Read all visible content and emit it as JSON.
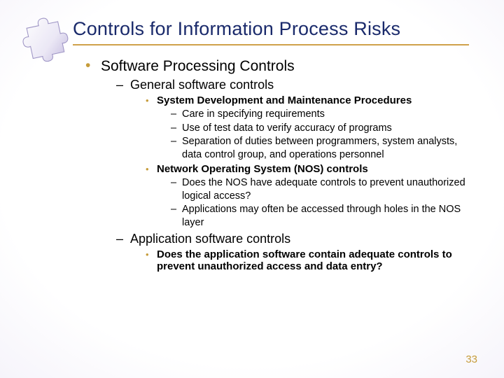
{
  "title": "Controls for Information Process Risks",
  "bullets": {
    "l1_0": "Software Processing Controls",
    "l2_0": "General software controls",
    "l3_0": "System Development and Maintenance Procedures",
    "l4_0_0": "Care in specifying requirements",
    "l4_0_1": "Use of test data to verify accuracy of programs",
    "l4_0_2": "Separation of duties between programmers, system analysts, data control group, and operations personnel",
    "l3_1": "Network Operating System (NOS) controls",
    "l4_1_0": "Does the NOS have adequate controls to prevent unauthorized logical access?",
    "l4_1_1": "Applications may often be accessed through holes in the NOS layer",
    "l2_1": "Application software controls",
    "l3_2": "Does the application software contain adequate controls to prevent unauthorized access and data entry?"
  },
  "page_number": "33",
  "colors": {
    "title": "#1a2a6b",
    "accent": "#c69c3a",
    "bg_outer": "#6f63a8"
  }
}
